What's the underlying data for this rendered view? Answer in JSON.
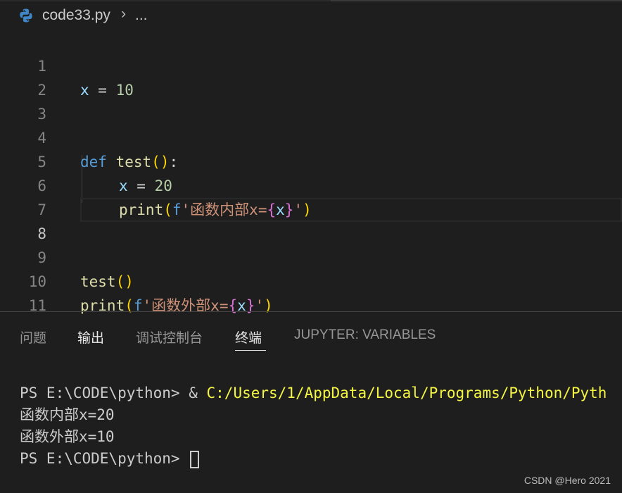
{
  "breadcrumb": {
    "icon": "python-file-icon",
    "file": "code33.py",
    "separator": "›",
    "more": "..."
  },
  "editor": {
    "lines": [
      {
        "n": "1"
      },
      {
        "n": "2"
      },
      {
        "n": "3"
      },
      {
        "n": "4"
      },
      {
        "n": "5"
      },
      {
        "n": "6"
      },
      {
        "n": "7"
      },
      {
        "n": "8"
      },
      {
        "n": "9"
      },
      {
        "n": "10"
      },
      {
        "n": "11"
      }
    ],
    "tokens": {
      "l1_var": "x",
      "l1_eq": " = ",
      "l1_num": "10",
      "l4_def": "def",
      "l4_sp": " ",
      "l4_fn": "test",
      "l4_paren": "()",
      "l4_colon": ":",
      "l5_var": "x",
      "l5_eq": " = ",
      "l5_num": "20",
      "l6_fn": "print",
      "l6_open": "(",
      "l6_f": "f",
      "l6_str1": "'函数内部x=",
      "l6_bo": "{",
      "l6_x": "x",
      "l6_bc": "}",
      "l6_str2": "'",
      "l6_close": ")",
      "l9_fn": "test",
      "l9_paren": "()",
      "l10_fn": "print",
      "l10_open": "(",
      "l10_f": "f",
      "l10_str1": "'函数外部x=",
      "l10_bo": "{",
      "l10_x": "x",
      "l10_bc": "}",
      "l10_str2": "'",
      "l10_close": ")"
    }
  },
  "panel": {
    "tabs": [
      "问题",
      "输出",
      "调试控制台",
      "终端",
      "JUPYTER: VARIABLES"
    ],
    "active_tab": "终端"
  },
  "terminal": {
    "prompt": "PS E:\\CODE\\python> ",
    "amp": "& ",
    "command": "C:/Users/1/AppData/Local/Programs/Python/Pyth",
    "out1": "函数内部x=20",
    "out2": "函数外部x=10",
    "prompt2": "PS E:\\CODE\\python> "
  },
  "watermark": "CSDN @Hero 2021",
  "colors": {
    "background": "#1e1e1e",
    "keyword": "#569cd6",
    "variable": "#9cdcfe",
    "number": "#b5cea8",
    "function": "#dcdcaa",
    "string": "#ce9178",
    "bracket1": "#ffd700",
    "bracket2": "#da70d6",
    "terminal_path": "#f5f543"
  }
}
